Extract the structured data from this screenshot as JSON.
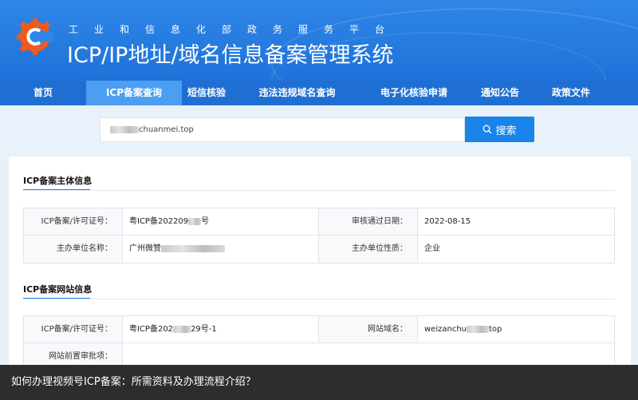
{
  "header": {
    "subtitle": "工业和信息化部政务服务平台",
    "title": "ICP/IP地址/域名信息备案管理系统"
  },
  "nav": {
    "items": [
      {
        "label": "首页",
        "name": "nav-home",
        "active": false
      },
      {
        "label": "ICP备案查询",
        "name": "nav-icp-query",
        "active": true
      },
      {
        "label": "短信核验",
        "name": "nav-sms-verify",
        "active": false
      },
      {
        "label": "违法违规域名查询",
        "name": "nav-illegal-domain",
        "active": false
      },
      {
        "label": "电子化核验申请",
        "name": "nav-e-verify",
        "active": false
      },
      {
        "label": "通知公告",
        "name": "nav-notice",
        "active": false
      },
      {
        "label": "政策文件",
        "name": "nav-policy",
        "active": false
      }
    ]
  },
  "search": {
    "value": "chuanmei.top",
    "button_label": "搜索"
  },
  "subject_section": {
    "title": "ICP备案主体信息",
    "rows": [
      {
        "label1": "ICP备案/许可证号：",
        "value1_prefix": "粤ICP备202209",
        "value1_suffix": "号",
        "label2": "审核通过日期：",
        "value2": "2022-08-15"
      },
      {
        "label1": "主办单位名称：",
        "value1_prefix": "广州微赞",
        "value1_suffix": "",
        "label2": "主办单位性质：",
        "value2": "企业"
      }
    ]
  },
  "site_section": {
    "title": "ICP备案网站信息",
    "rows": [
      {
        "label1": "ICP备案/许可证号：",
        "value1_prefix": "粤ICP备202",
        "value1_suffix": "29号-1",
        "label2": "网站域名：",
        "value2_prefix": "weizanchu",
        "value2_suffix": "top"
      },
      {
        "label1": "网站前置审批项：",
        "value1_prefix": "",
        "value1_suffix": "",
        "label2": "",
        "value2_prefix": "",
        "value2_suffix": ""
      }
    ]
  },
  "caption": "如何办理视频号ICP备案：所需资料及办理流程介绍？",
  "colors": {
    "header_blue": "#2f86e6",
    "nav_blue": "#1f6fd3",
    "nav_active": "#4c9ef0",
    "accent": "#1a84ea",
    "logo_orange": "#f05a1a"
  }
}
